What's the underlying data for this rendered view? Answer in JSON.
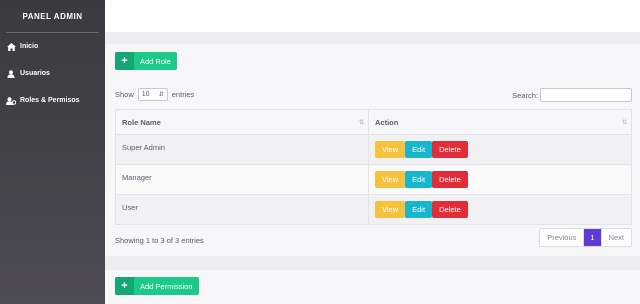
{
  "sidebar": {
    "brand": "PANEL ADMIN",
    "items": [
      {
        "label": "Inicio",
        "icon": "home-icon"
      },
      {
        "label": "Usuarios",
        "icon": "user-icon"
      },
      {
        "label": "Roles & Permisos",
        "icon": "users-cog-icon"
      }
    ]
  },
  "roles": {
    "add_label": "Add Role",
    "add_icon": "+",
    "show_label": "Show",
    "entries_value": "10",
    "entries_label": "entries",
    "search_label": "Search:",
    "search_value": "",
    "columns": [
      "Role Name",
      "Action"
    ],
    "rows": [
      {
        "name": "Super Admin"
      },
      {
        "name": "Manager"
      },
      {
        "name": "User"
      }
    ],
    "actions": {
      "view": "View",
      "edit": "Edit",
      "delete": "Delete"
    },
    "info": "Showing 1 to 3 of 3 entries",
    "pagination": {
      "previous": "Previous",
      "current": "1",
      "next": "Next"
    }
  },
  "permissions": {
    "add_label": "Add Permission",
    "add_icon": "+"
  },
  "colors": {
    "primary_success": "#1cc88a",
    "view": "#f6c23e",
    "edit": "#17b6cc",
    "delete": "#e02d3a",
    "page_active": "#5f3bd6"
  }
}
